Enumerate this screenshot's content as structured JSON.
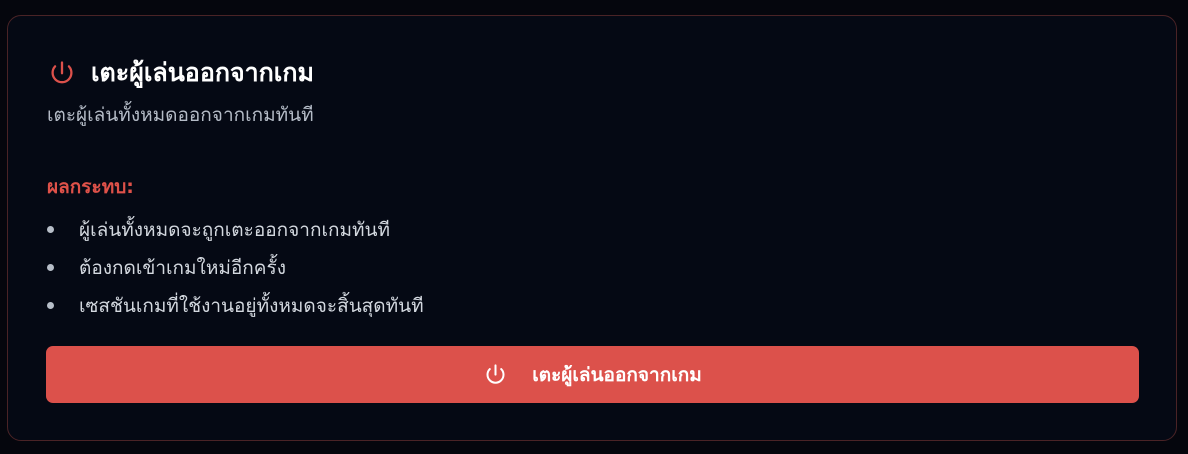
{
  "card": {
    "title": "เตะผู้เล่นออกจากเกม",
    "title_icon": "power-icon",
    "subtitle": "เตะผู้เล่นทั้งหมดออกจากเกมทันที",
    "impact": {
      "heading": "ผลกระทบ:",
      "items": [
        "ผู้เล่นทั้งหมดจะถูกเตะออกจากเกมทันที",
        "ต้องกดเข้าเกมใหม่อีกครั้ง",
        "เซสชันเกมที่ใช้งานอยู่ทั้งหมดจะสิ้นสุดทันที"
      ]
    },
    "button": {
      "label": "เตะผู้เล่นออกจากเกม",
      "icon": "power-icon"
    }
  },
  "colors": {
    "background": "#05060d",
    "card_background": "#050914",
    "card_border": "#4a2326",
    "accent": "#dc514b",
    "heading": "#ffffff",
    "muted_text": "#b5bcc7"
  }
}
